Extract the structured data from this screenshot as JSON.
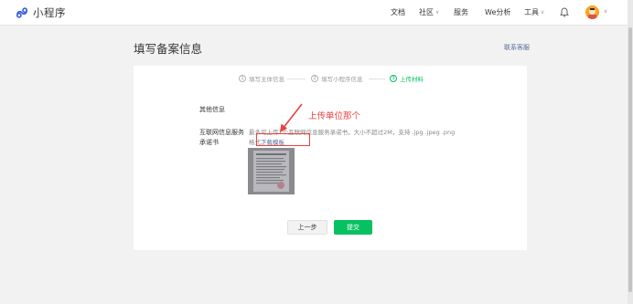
{
  "header": {
    "brand": "小程序",
    "nav": [
      {
        "label": "文档",
        "has_dropdown": false
      },
      {
        "label": "社区",
        "has_dropdown": true
      },
      {
        "label": "服务",
        "has_dropdown": false
      },
      {
        "label": "We分析",
        "has_dropdown": false
      },
      {
        "label": "工具",
        "has_dropdown": true
      }
    ],
    "icons": [
      "bell-icon",
      "avatar",
      "chevron-down-icon"
    ]
  },
  "page": {
    "title": "填写备案信息",
    "contact_link": "联系客服"
  },
  "steps": [
    {
      "num": "1",
      "label": "填写主体信息",
      "active": false
    },
    {
      "num": "2",
      "label": "填写小程序信息",
      "active": false
    },
    {
      "num": "3",
      "label": "上传材料",
      "active": true
    }
  ],
  "form": {
    "section_title": "其他信息",
    "field_label": "互联网信息服务承诺书",
    "field_desc": "最多可上传1个互联网信息服务承诺书，大小不超过2M，支持 .jpg .jpeg .png 格式。",
    "template_link": "下载模板"
  },
  "annotation": {
    "text": "上传单位那个"
  },
  "buttons": {
    "prev": "上一步",
    "submit": "提交"
  },
  "colors": {
    "accent": "#07c160",
    "link": "#576b95",
    "annotation": "#e64340",
    "background": "#f2f2f2"
  }
}
